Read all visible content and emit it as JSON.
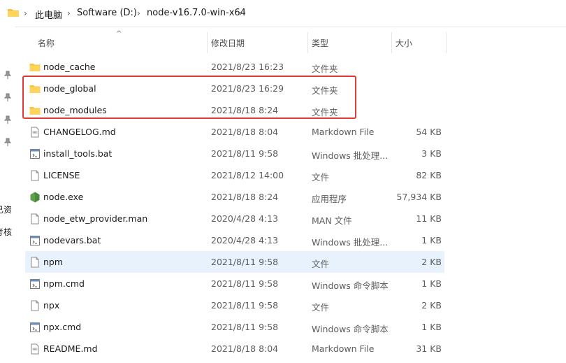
{
  "address": {
    "crumbs": [
      "此电脑",
      "Software (D:)",
      "node-v16.7.0-win-x64"
    ]
  },
  "nav_fragments": [
    "已资",
    "考核"
  ],
  "columns": {
    "name": "名称",
    "date": "修改日期",
    "type": "类型",
    "size": "大小"
  },
  "files": [
    {
      "name": "node_cache",
      "date": "2021/8/23 16:23",
      "type": "文件夹",
      "size": "",
      "icon": "folder-icon"
    },
    {
      "name": "node_global",
      "date": "2021/8/23 16:29",
      "type": "文件夹",
      "size": "",
      "icon": "folder-icon"
    },
    {
      "name": "node_modules",
      "date": "2021/8/18 8:24",
      "type": "文件夹",
      "size": "",
      "icon": "folder-icon"
    },
    {
      "name": "CHANGELOG.md",
      "date": "2021/8/18 8:04",
      "type": "Markdown File",
      "size": "54 KB",
      "icon": "markdown-file-icon"
    },
    {
      "name": "install_tools.bat",
      "date": "2021/8/11 9:58",
      "type": "Windows 批处理...",
      "size": "3 KB",
      "icon": "batch-file-icon"
    },
    {
      "name": "LICENSE",
      "date": "2021/8/12 14:00",
      "type": "文件",
      "size": "82 KB",
      "icon": "generic-file-icon"
    },
    {
      "name": "node.exe",
      "date": "2021/8/18 8:24",
      "type": "应用程序",
      "size": "57,934 KB",
      "icon": "nodejs-icon"
    },
    {
      "name": "node_etw_provider.man",
      "date": "2020/4/28 4:13",
      "type": "MAN 文件",
      "size": "11 KB",
      "icon": "generic-file-icon"
    },
    {
      "name": "nodevars.bat",
      "date": "2020/4/28 4:13",
      "type": "Windows 批处理...",
      "size": "1 KB",
      "icon": "batch-file-icon"
    },
    {
      "name": "npm",
      "date": "2021/8/11 9:58",
      "type": "文件",
      "size": "2 KB",
      "icon": "generic-file-icon"
    },
    {
      "name": "npm.cmd",
      "date": "2021/8/11 9:58",
      "type": "Windows 命令脚本",
      "size": "1 KB",
      "icon": "batch-file-icon"
    },
    {
      "name": "npx",
      "date": "2021/8/11 9:58",
      "type": "文件",
      "size": "2 KB",
      "icon": "generic-file-icon"
    },
    {
      "name": "npx.cmd",
      "date": "2021/8/11 9:58",
      "type": "Windows 命令脚本",
      "size": "1 KB",
      "icon": "batch-file-icon"
    },
    {
      "name": "README.md",
      "date": "2021/8/18 8:04",
      "type": "Markdown File",
      "size": "31 KB",
      "icon": "markdown-file-icon"
    }
  ],
  "colors": {
    "folder": "#f8c13c",
    "highlight": "#e53935",
    "hover_row": "#e8f2fc",
    "node_green": "#5fa04e"
  }
}
